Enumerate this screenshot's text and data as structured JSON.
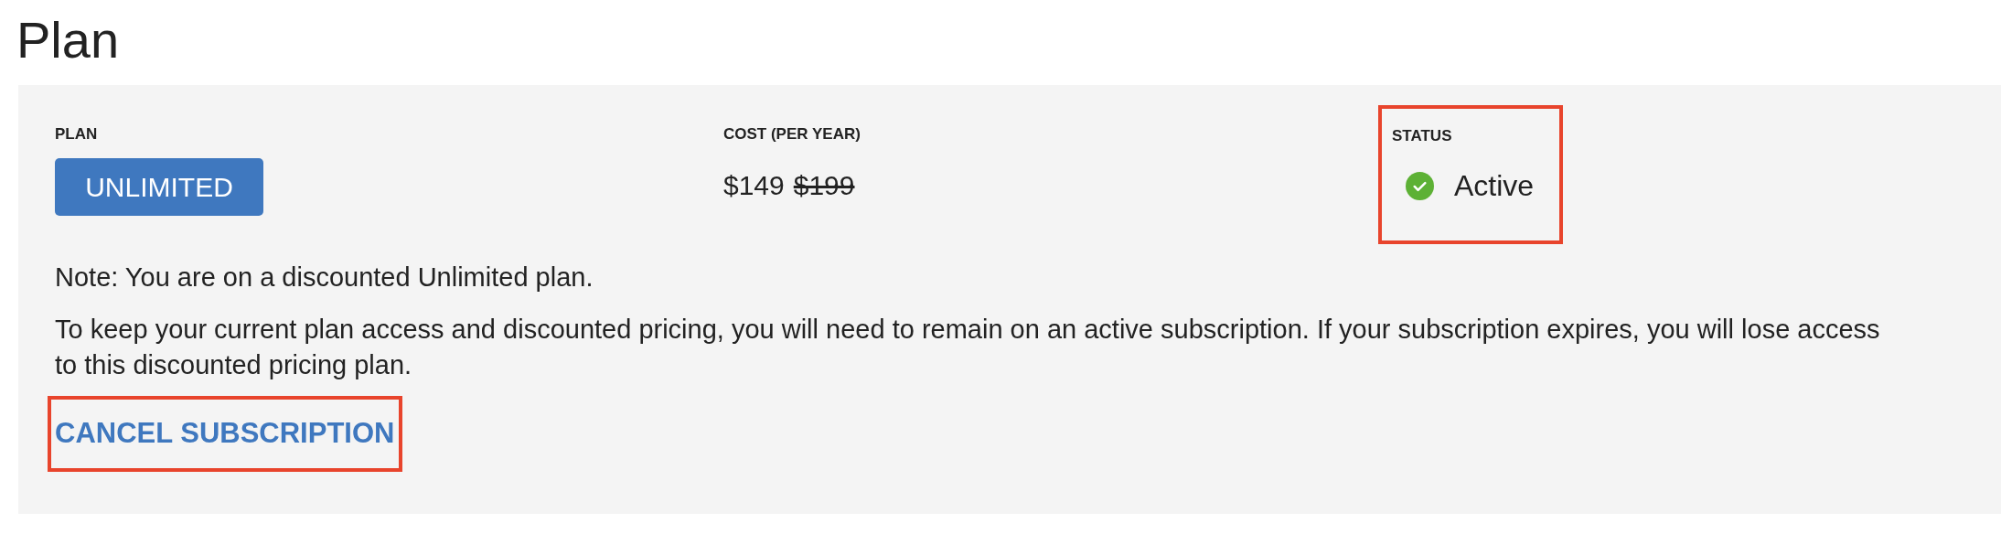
{
  "title": "Plan",
  "plan": {
    "label": "PLAN",
    "name": "UNLIMITED"
  },
  "cost": {
    "label": "COST (PER YEAR)",
    "price": "$149",
    "original_price": "$199"
  },
  "status": {
    "label": "STATUS",
    "value": "Active",
    "kind": "active",
    "highlighted": true
  },
  "note": "Note: You are on a discounted Unlimited plan.",
  "description": "To keep your current plan access and discounted pricing, you will need to remain on an active subscription. If your subscription expires, you will lose access to this discounted pricing plan.",
  "cancel": {
    "label": "CANCEL SUBSCRIPTION",
    "highlighted": true
  }
}
